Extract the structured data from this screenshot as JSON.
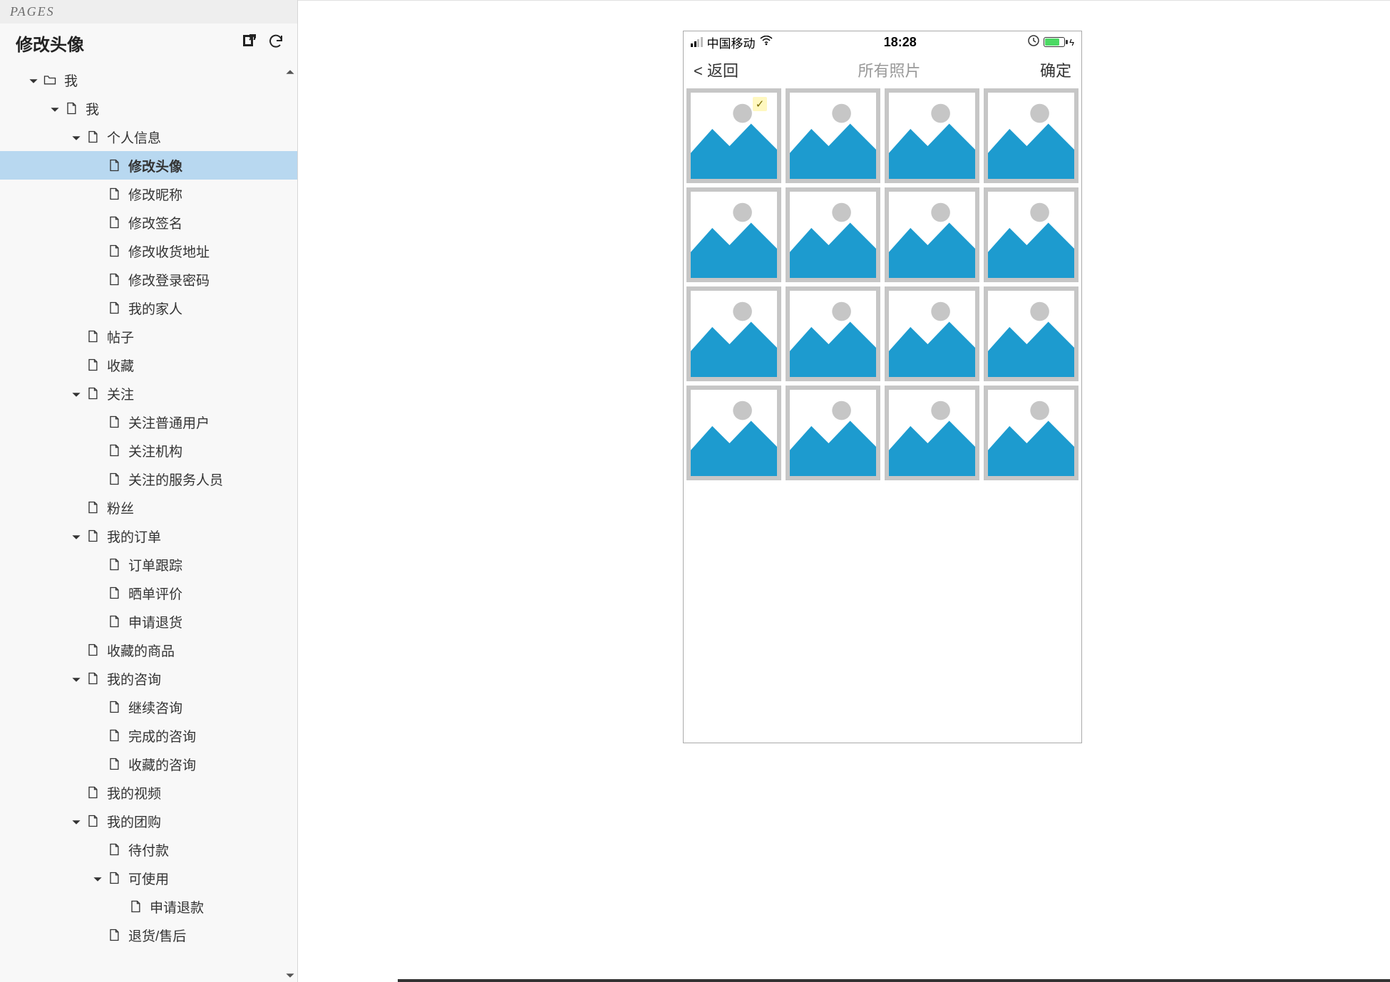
{
  "panel": {
    "header": "PAGES",
    "title": "修改头像"
  },
  "tree": [
    {
      "depth": 0,
      "arrow": true,
      "icon": "folder",
      "label": "我"
    },
    {
      "depth": 1,
      "arrow": true,
      "icon": "page",
      "label": "我"
    },
    {
      "depth": 2,
      "arrow": true,
      "icon": "page",
      "label": "个人信息"
    },
    {
      "depth": 3,
      "arrow": false,
      "icon": "page",
      "label": "修改头像",
      "selected": true
    },
    {
      "depth": 3,
      "arrow": false,
      "icon": "page",
      "label": "修改昵称"
    },
    {
      "depth": 3,
      "arrow": false,
      "icon": "page",
      "label": "修改签名"
    },
    {
      "depth": 3,
      "arrow": false,
      "icon": "page",
      "label": "修改收货地址"
    },
    {
      "depth": 3,
      "arrow": false,
      "icon": "page",
      "label": "修改登录密码"
    },
    {
      "depth": 3,
      "arrow": false,
      "icon": "page",
      "label": "我的家人"
    },
    {
      "depth": 2,
      "arrow": false,
      "icon": "page",
      "label": "帖子"
    },
    {
      "depth": 2,
      "arrow": false,
      "icon": "page",
      "label": "收藏"
    },
    {
      "depth": 2,
      "arrow": true,
      "icon": "page",
      "label": "关注"
    },
    {
      "depth": 3,
      "arrow": false,
      "icon": "page",
      "label": "关注普通用户"
    },
    {
      "depth": 3,
      "arrow": false,
      "icon": "page",
      "label": "关注机构"
    },
    {
      "depth": 3,
      "arrow": false,
      "icon": "page",
      "label": "关注的服务人员"
    },
    {
      "depth": 2,
      "arrow": false,
      "icon": "page",
      "label": "粉丝"
    },
    {
      "depth": 2,
      "arrow": true,
      "icon": "page",
      "label": "我的订单"
    },
    {
      "depth": 3,
      "arrow": false,
      "icon": "page",
      "label": "订单跟踪"
    },
    {
      "depth": 3,
      "arrow": false,
      "icon": "page",
      "label": "晒单评价"
    },
    {
      "depth": 3,
      "arrow": false,
      "icon": "page",
      "label": "申请退货"
    },
    {
      "depth": 2,
      "arrow": false,
      "icon": "page",
      "label": "收藏的商品"
    },
    {
      "depth": 2,
      "arrow": true,
      "icon": "page",
      "label": "我的咨询"
    },
    {
      "depth": 3,
      "arrow": false,
      "icon": "page",
      "label": "继续咨询"
    },
    {
      "depth": 3,
      "arrow": false,
      "icon": "page",
      "label": "完成的咨询"
    },
    {
      "depth": 3,
      "arrow": false,
      "icon": "page",
      "label": "收藏的咨询"
    },
    {
      "depth": 2,
      "arrow": false,
      "icon": "page",
      "label": "我的视频"
    },
    {
      "depth": 2,
      "arrow": true,
      "icon": "page",
      "label": "我的团购"
    },
    {
      "depth": 3,
      "arrow": false,
      "icon": "page",
      "label": "待付款"
    },
    {
      "depth": 3,
      "arrow": true,
      "icon": "page",
      "label": "可使用"
    },
    {
      "depth": 4,
      "arrow": false,
      "icon": "page",
      "label": "申请退款"
    },
    {
      "depth": 3,
      "arrow": false,
      "icon": "page",
      "label": "退货/售后"
    }
  ],
  "phone": {
    "carrier": "中国移动",
    "time": "18:28",
    "nav": {
      "back": "< 返回",
      "title": "所有照片",
      "confirm": "确定"
    },
    "photo_count": 16,
    "selected_index": 0
  }
}
